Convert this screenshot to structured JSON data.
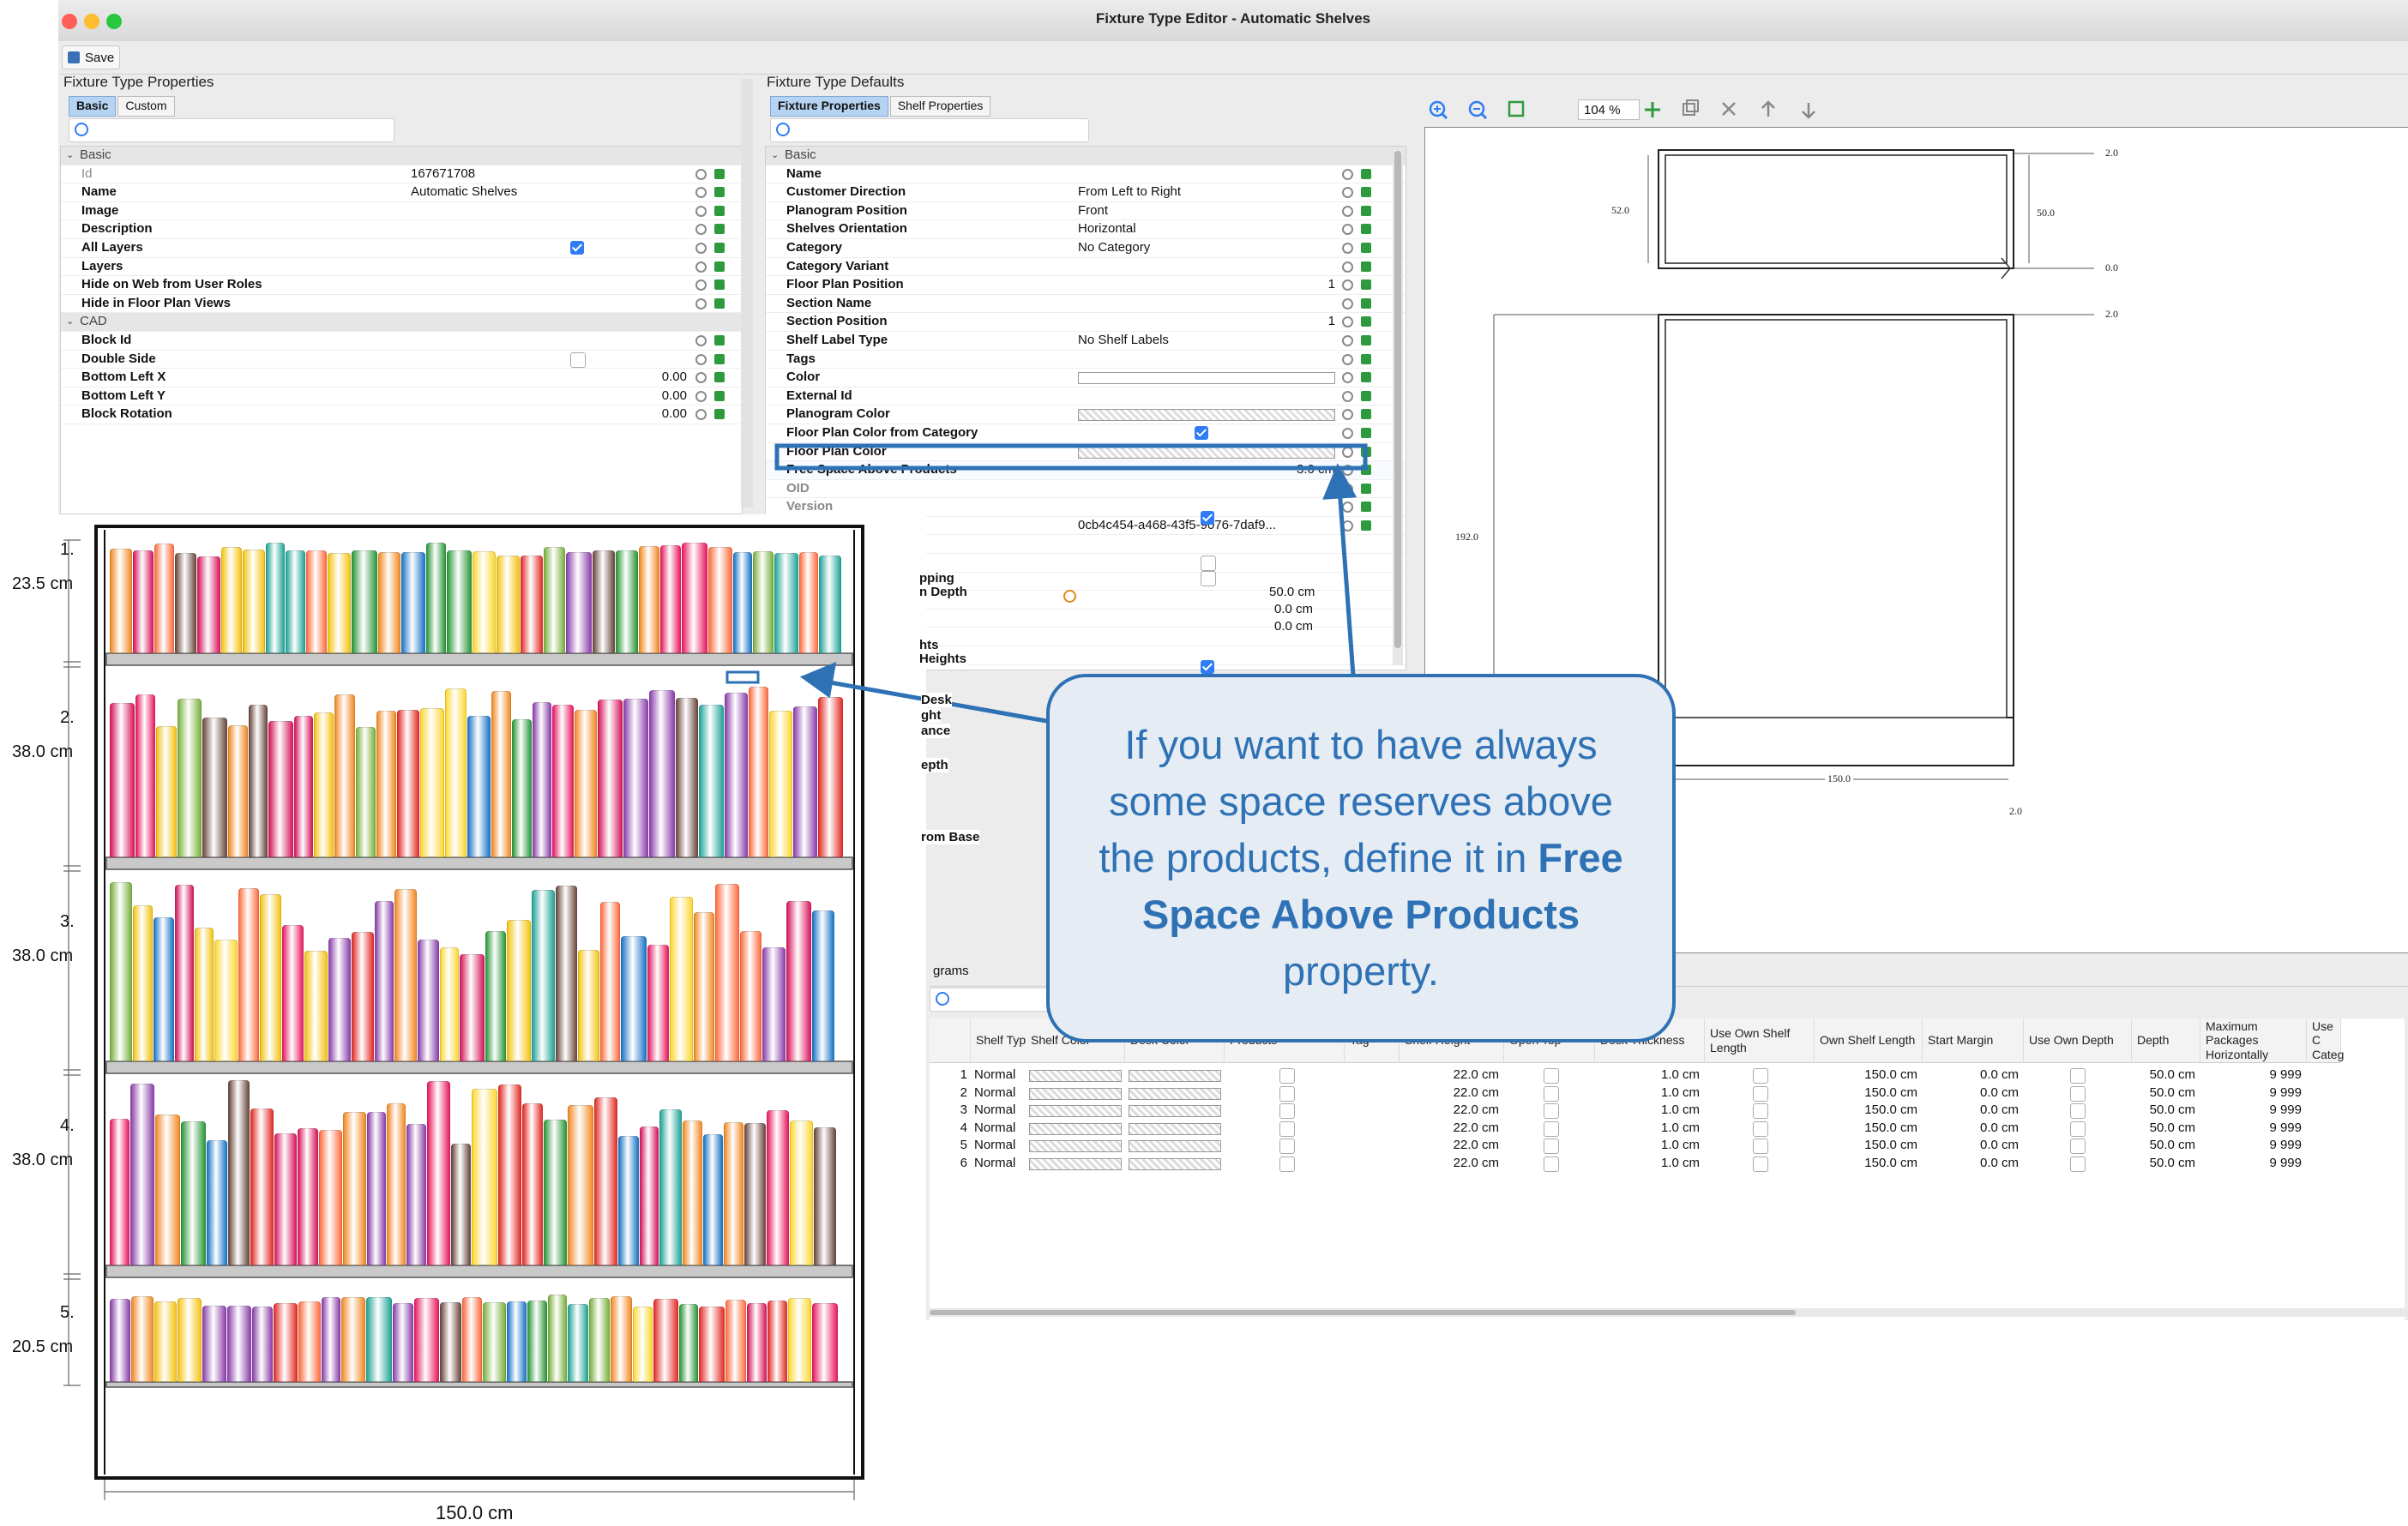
{
  "window": {
    "title": "Fixture Type Editor - Automatic Shelves",
    "save_label": "Save"
  },
  "left_panel": {
    "title": "Fixture Type Properties",
    "tabs": [
      "Basic",
      "Custom"
    ],
    "groups": [
      {
        "name": "Basic",
        "rows": [
          {
            "key": "Id",
            "value": "167671708",
            "dim": true
          },
          {
            "key": "Name",
            "value": "Automatic Shelves"
          },
          {
            "key": "Image",
            "value": ""
          },
          {
            "key": "Description",
            "value": ""
          },
          {
            "key": "All Layers",
            "value": "",
            "check": "on"
          },
          {
            "key": "Layers",
            "value": ""
          },
          {
            "key": "Hide on Web from User Roles",
            "value": ""
          },
          {
            "key": "Hide in Floor Plan Views",
            "value": ""
          }
        ]
      },
      {
        "name": "CAD",
        "rows": [
          {
            "key": "Block Id",
            "value": ""
          },
          {
            "key": "Double Side",
            "value": "",
            "check": "off"
          },
          {
            "key": "Bottom Left X",
            "value": "0.00",
            "num": true
          },
          {
            "key": "Bottom Left Y",
            "value": "0.00",
            "num": true
          },
          {
            "key": "Block Rotation",
            "value": "0.00",
            "num": true
          }
        ]
      }
    ]
  },
  "middle_panel": {
    "title": "Fixture Type Defaults",
    "tabs": [
      "Fixture Properties",
      "Shelf Properties"
    ],
    "group": "Basic",
    "rows": [
      {
        "key": "Name",
        "value": ""
      },
      {
        "key": "Customer Direction",
        "value": "From Left to Right"
      },
      {
        "key": "Planogram Position",
        "value": "Front"
      },
      {
        "key": "Shelves Orientation",
        "value": "Horizontal"
      },
      {
        "key": "Category",
        "value": "No Category"
      },
      {
        "key": "Category Variant",
        "value": ""
      },
      {
        "key": "Floor Plan Position",
        "value": "1",
        "num": true
      },
      {
        "key": "Section Name",
        "value": ""
      },
      {
        "key": "Section Position",
        "value": "1",
        "num": true
      },
      {
        "key": "Shelf Label Type",
        "value": "No Shelf Labels"
      },
      {
        "key": "Tags",
        "value": ""
      },
      {
        "key": "Color",
        "value": "",
        "swatch": "plain"
      },
      {
        "key": "External Id",
        "value": ""
      },
      {
        "key": "Planogram Color",
        "value": "",
        "swatch": "pattern"
      },
      {
        "key": "Floor Plan Color from Category",
        "value": "",
        "check": "on"
      },
      {
        "key": "Floor Plan Color",
        "value": "",
        "swatch": "pattern"
      },
      {
        "key": "Free Space Above Products",
        "value": "3.0 cm",
        "num": true,
        "highlight": true
      },
      {
        "key": "OID",
        "value": "",
        "dim": true
      },
      {
        "key": "Version",
        "value": "",
        "dim": true
      },
      {
        "key": "UUID",
        "value": "0cb4c454-a468-43f5-9076-7daf9...",
        "dim": true
      }
    ],
    "partial_rows": [
      "pping",
      "n Depth",
      "hts",
      "Heights",
      "Desk",
      "ght",
      "ance",
      "epth",
      "rom Base"
    ],
    "partial_values": [
      "50.0 cm",
      "0.0 cm",
      "0.0 cm"
    ]
  },
  "drawing_toolbar": {
    "zoom": "104 %"
  },
  "drawing": {
    "labels": {
      "top_gap": "2.0",
      "top_height": "52.0",
      "top_depth": "50.0",
      "zero": "0.0",
      "gap2": "2.0",
      "total_height": "192.0",
      "width": "150.0",
      "bottom_gap": "2.0"
    }
  },
  "bottom_tab": "grams",
  "grid": {
    "headers": [
      "",
      "Shelf Type",
      "Shelf Color",
      "Desk Color",
      "Products",
      "Tag",
      "Shelf Height",
      "Open Top",
      "Desk Thickness",
      "Use Own Shelf Length",
      "Own Shelf Length",
      "Start Margin",
      "Use Own Depth",
      "Depth",
      "Maximum Packages Horizontally",
      "Use C Categ"
    ],
    "rows": [
      {
        "n": "1",
        "type": "Normal",
        "height": "22.0 cm",
        "thick": "1.0 cm",
        "len": "150.0 cm",
        "margin": "0.0 cm",
        "depth": "50.0 cm",
        "max": "9 999"
      },
      {
        "n": "2",
        "type": "Normal",
        "height": "22.0 cm",
        "thick": "1.0 cm",
        "len": "150.0 cm",
        "margin": "0.0 cm",
        "depth": "50.0 cm",
        "max": "9 999"
      },
      {
        "n": "3",
        "type": "Normal",
        "height": "22.0 cm",
        "thick": "1.0 cm",
        "len": "150.0 cm",
        "margin": "0.0 cm",
        "depth": "50.0 cm",
        "max": "9 999"
      },
      {
        "n": "4",
        "type": "Normal",
        "height": "22.0 cm",
        "thick": "1.0 cm",
        "len": "150.0 cm",
        "margin": "0.0 cm",
        "depth": "50.0 cm",
        "max": "9 999"
      },
      {
        "n": "5",
        "type": "Normal",
        "height": "22.0 cm",
        "thick": "1.0 cm",
        "len": "150.0 cm",
        "margin": "0.0 cm",
        "depth": "50.0 cm",
        "max": "9 999"
      },
      {
        "n": "6",
        "type": "Normal",
        "height": "22.0 cm",
        "thick": "1.0 cm",
        "len": "150.0 cm",
        "margin": "0.0 cm",
        "depth": "50.0 cm",
        "max": "9 999"
      }
    ]
  },
  "fixture": {
    "shelves": [
      {
        "num": "1.",
        "height": "23.5 cm"
      },
      {
        "num": "2.",
        "height": "38.0 cm"
      },
      {
        "num": "3.",
        "height": "38.0 cm"
      },
      {
        "num": "4.",
        "height": "38.0 cm"
      },
      {
        "num": "5.",
        "height": "20.5 cm"
      }
    ],
    "width": "150.0 cm"
  },
  "callout": {
    "pre": "If you want to have always some space reserves above the products, define it in ",
    "bold": "Free Space Above Products",
    "post": " property."
  },
  "colors": {
    "accent": "#2e72b5",
    "callout_bg": "#e6ecf3",
    "tab_selected": "#b7d3f2",
    "check": "#2f7cf6"
  }
}
